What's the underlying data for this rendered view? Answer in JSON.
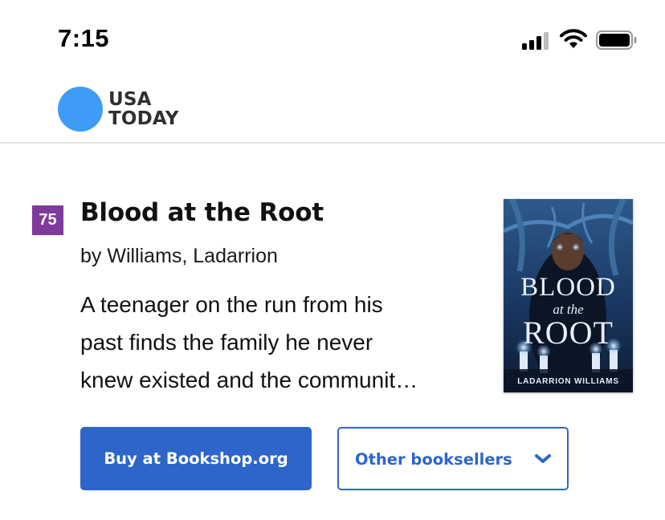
{
  "status_bar": {
    "time": "7:15",
    "icons": [
      "signal-icon",
      "wifi-icon",
      "battery-icon"
    ]
  },
  "header": {
    "logo_line1": "USA",
    "logo_line2": "TODAY",
    "logo_color": "#3f9cf6"
  },
  "book": {
    "rank": "75",
    "title": "Blood at the Root",
    "author": "by Williams, Ladarrion",
    "description_lines": [
      "A teenager on the run from his",
      "past finds the family he never",
      "knew existed and the communit…"
    ],
    "cover": {
      "title_line1": "BLOOD",
      "title_line2": "at the",
      "title_line3": "ROOT",
      "author": "LADARRION WILLIAMS"
    }
  },
  "actions": {
    "buy_label": "Buy at Bookshop.org",
    "other_label": "Other booksellers"
  },
  "colors": {
    "accent": "#2d66c8",
    "rank_badge": "#7f3a9d"
  }
}
